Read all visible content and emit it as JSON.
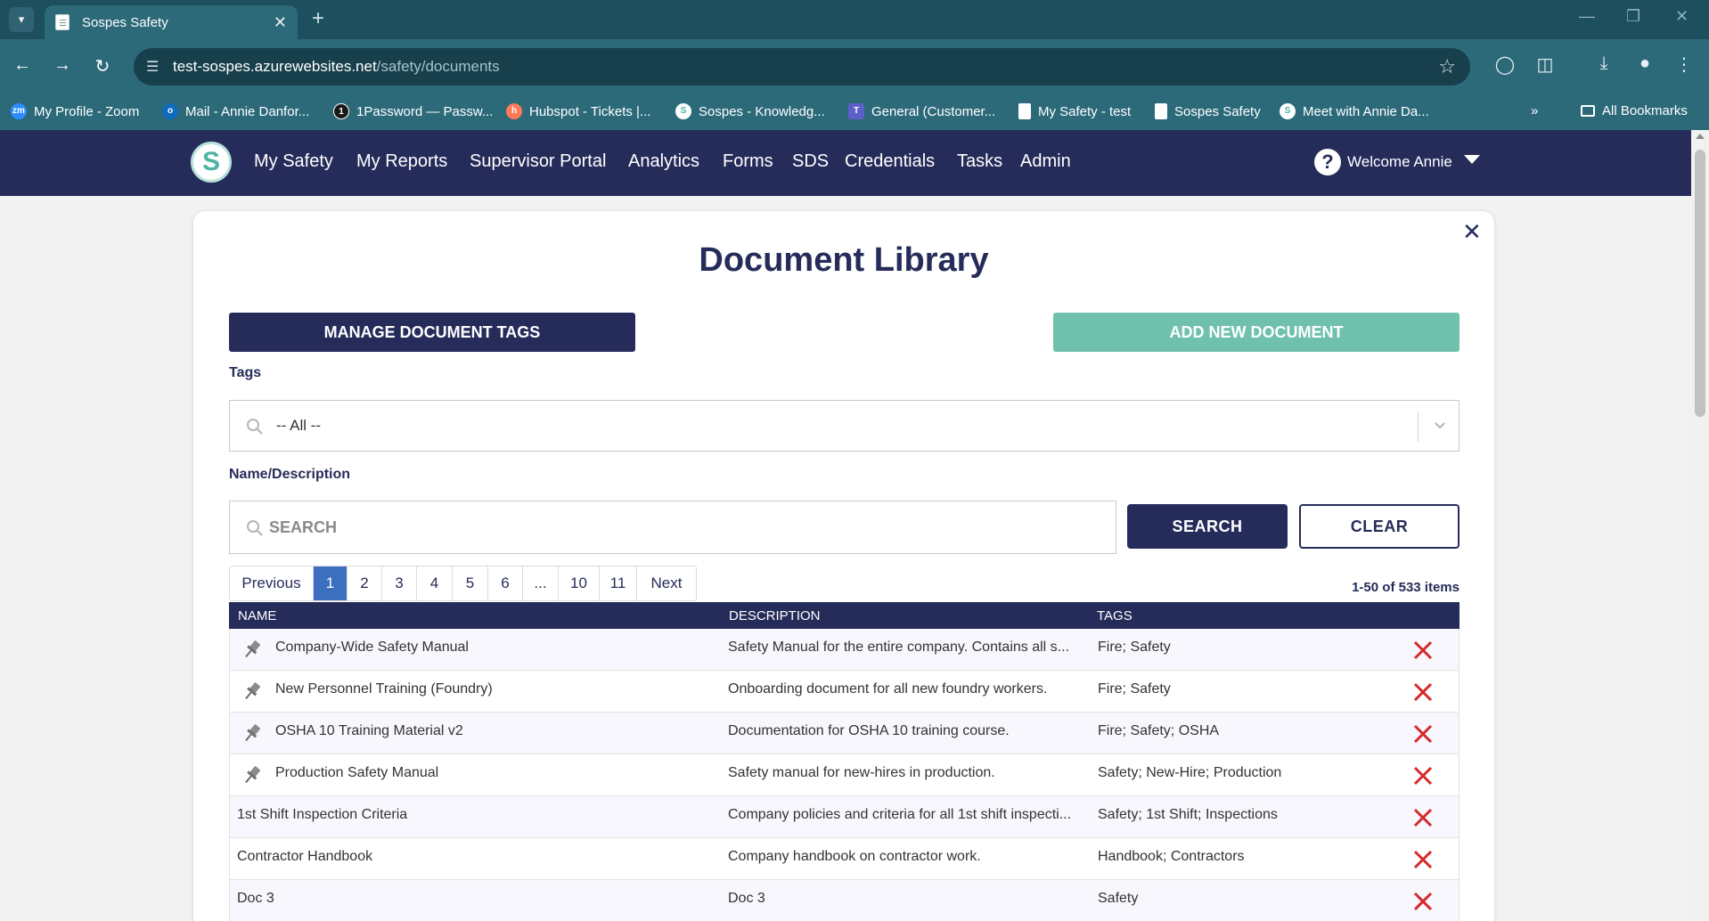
{
  "browser": {
    "tab_title": "Sospes Safety",
    "url_host": "test-sospes.azurewebsites.net",
    "url_path": "/safety/documents",
    "bookmarks": [
      {
        "label": "My Profile - Zoom",
        "icon": "zoom-icon",
        "color": "#2d8cff"
      },
      {
        "label": "Mail - Annie Danfor...",
        "icon": "outlook-icon",
        "color": "#0f6cbd"
      },
      {
        "label": "1Password — Passw...",
        "icon": "1password-icon",
        "color": "#1a1a1a"
      },
      {
        "label": "Hubspot - Tickets |...",
        "icon": "hubspot-icon",
        "color": "#ff7a59"
      },
      {
        "label": "Sospes - Knowledg...",
        "icon": "sospes-icon",
        "color": "#4bb5a2"
      },
      {
        "label": "General (Customer...",
        "icon": "teams-icon",
        "color": "#5b5fc7"
      },
      {
        "label": "My Safety - test",
        "icon": "page-icon",
        "color": "#ffffff"
      },
      {
        "label": "Sospes Safety",
        "icon": "page-icon",
        "color": "#ffffff"
      },
      {
        "label": "Meet with Annie Da...",
        "icon": "sospes-icon",
        "color": "#4bb5a2"
      }
    ],
    "all_bookmarks": "All Bookmarks"
  },
  "nav": {
    "logo_letter": "S",
    "links": [
      "My Safety",
      "My Reports",
      "Supervisor Portal",
      "Analytics",
      "Forms",
      "SDS",
      "Credentials",
      "Tasks",
      "Admin"
    ],
    "welcome": "Welcome Annie"
  },
  "page": {
    "title": "Document Library",
    "manage_tags_label": "MANAGE DOCUMENT TAGS",
    "add_document_label": "ADD NEW DOCUMENT",
    "tags_label": "Tags",
    "tags_value": "-- All --",
    "name_desc_label": "Name/Description",
    "search_placeholder": "SEARCH",
    "search_button": "SEARCH",
    "clear_button": "CLEAR",
    "pager": [
      "Previous",
      "1",
      "2",
      "3",
      "4",
      "5",
      "6",
      "...",
      "10",
      "11",
      "Next"
    ],
    "pager_active": "1",
    "item_count": "1-50 of 533 items"
  },
  "table": {
    "headers": [
      "NAME",
      "DESCRIPTION",
      "TAGS"
    ],
    "rows": [
      {
        "name": "Company-Wide Safety Manual",
        "description": "Safety Manual for the entire company. Contains all s...",
        "tags": "Fire; Safety",
        "pinned": true
      },
      {
        "name": "New Personnel Training (Foundry)",
        "description": "Onboarding document for all new foundry workers.",
        "tags": "Fire; Safety",
        "pinned": true
      },
      {
        "name": "OSHA 10 Training Material v2",
        "description": "Documentation for OSHA 10 training course.",
        "tags": "Fire; Safety; OSHA",
        "pinned": true
      },
      {
        "name": "Production Safety Manual",
        "description": "Safety manual for new-hires in production.",
        "tags": "Safety; New-Hire; Production",
        "pinned": true
      },
      {
        "name": "1st Shift Inspection Criteria",
        "description": "Company policies and criteria for all 1st shift inspecti...",
        "tags": "Safety; 1st Shift; Inspections",
        "pinned": false
      },
      {
        "name": "Contractor Handbook",
        "description": "Company handbook on contractor work.",
        "tags": "Handbook; Contractors",
        "pinned": false
      },
      {
        "name": "Doc 3",
        "description": "Doc 3",
        "tags": "Safety",
        "pinned": false
      }
    ]
  },
  "colors": {
    "brand_navy": "#262c5a",
    "accent_teal": "#6fc1ad",
    "active_page": "#3d6fbf",
    "delete_red": "#d62828",
    "chrome_teal": "#2c6a7a"
  }
}
